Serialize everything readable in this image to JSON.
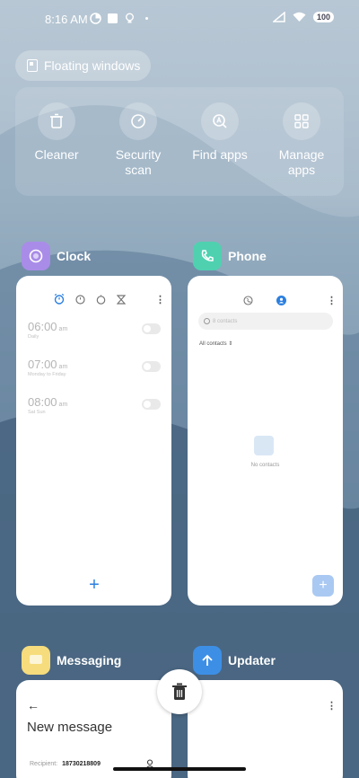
{
  "status_bar": {
    "time": "8:16 AM",
    "battery": "100"
  },
  "floating_windows": {
    "label": "Floating windows"
  },
  "quick_tools": [
    {
      "label": "Cleaner",
      "icon": "trash-icon"
    },
    {
      "label": "Security scan",
      "icon": "gauge-icon"
    },
    {
      "label": "Find apps",
      "icon": "search-app-icon"
    },
    {
      "label": "Manage apps",
      "icon": "grid-icon"
    }
  ],
  "apps": {
    "clock": {
      "name": "Clock",
      "icon_color": "#a98ce8",
      "alarms": [
        {
          "time": "06:00",
          "ampm": "am",
          "repeat": "Daily"
        },
        {
          "time": "07:00",
          "ampm": "am",
          "repeat": "Monday to Friday"
        },
        {
          "time": "08:00",
          "ampm": "am",
          "repeat": "Sat Sun"
        }
      ],
      "add": "+"
    },
    "phone": {
      "name": "Phone",
      "icon_color": "#4fd1b0",
      "search_placeholder": "8 contacts",
      "filter": "All contacts",
      "empty_text": "No contacts",
      "add": "+"
    },
    "messaging": {
      "name": "Messaging",
      "icon_color": "#f6dc7c",
      "back": "←",
      "title": "New message",
      "recipient_label": "Recipient:",
      "recipient_value": "18730218809"
    },
    "updater": {
      "name": "Updater",
      "icon_color": "#3d8fe6"
    }
  },
  "colors": {
    "accent": "#2b7fe0"
  }
}
